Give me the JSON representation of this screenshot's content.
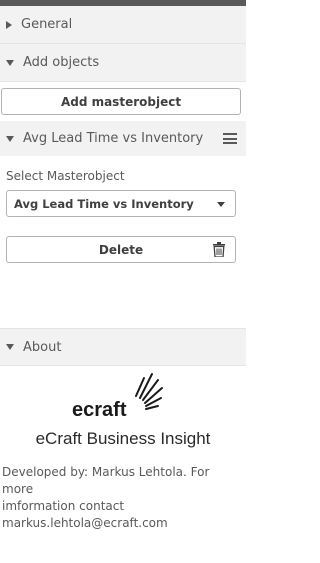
{
  "sections": {
    "general": {
      "label": "General"
    },
    "add_objects": {
      "label": "Add objects"
    },
    "about": {
      "label": "About"
    }
  },
  "add_objects": {
    "add_button_label": "Add masterobject",
    "item": {
      "title": "Avg Lead Time vs Inventory",
      "select_label": "Select Masterobject",
      "selected_value": "Avg Lead Time vs Inventory",
      "delete_label": "Delete"
    }
  },
  "about": {
    "logo_text": "ecraft",
    "title": "eCraft Business Insight",
    "developer_line1": "Developed by: Markus Lehtola. For more",
    "developer_line2": "imformation contact",
    "developer_line3": "markus.lehtola@ecraft.com"
  },
  "icons": {
    "menu": "hamburger-icon",
    "delete": "trash-icon",
    "dropdown": "chevron-down-icon"
  },
  "colors": {
    "header_bg": "#f2f2f2",
    "text": "#595959",
    "border": "#b3b3b3"
  }
}
